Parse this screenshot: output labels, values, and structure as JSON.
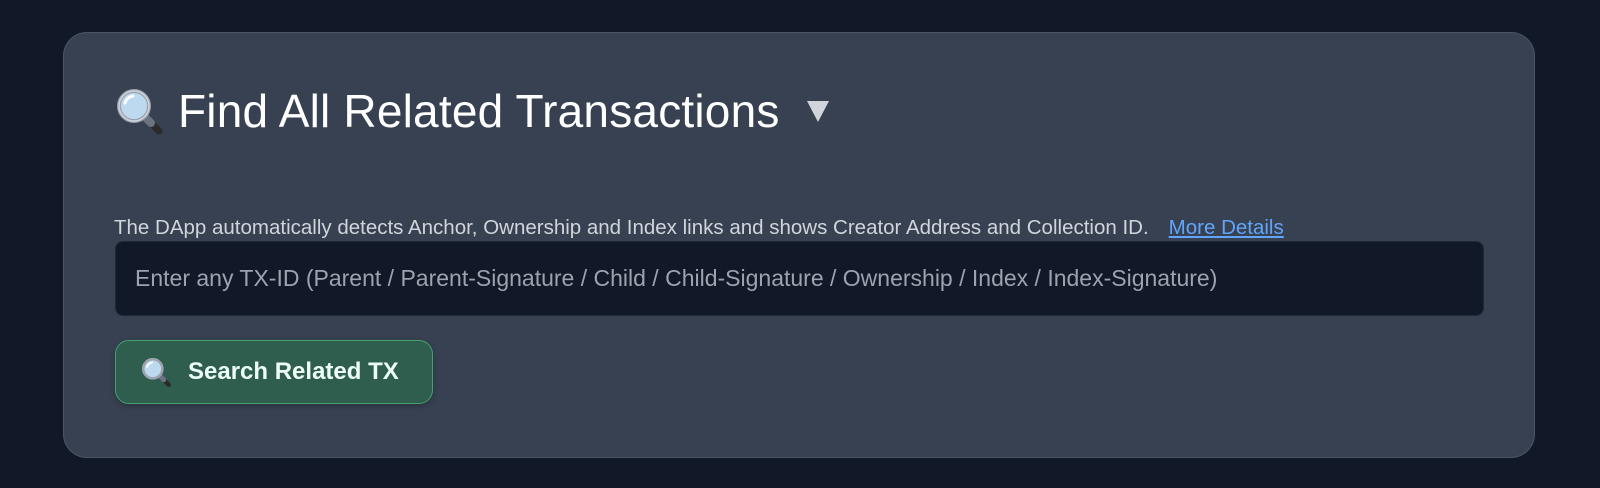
{
  "card": {
    "title": "Find All Related Transactions",
    "title_icon": "magnifying-glass-icon",
    "toggle_icon": "triangle-down-icon",
    "description": "The DApp automatically detects Anchor, Ownership and Index links and shows Creator Address and Collection ID.",
    "more_details_label": "More Details"
  },
  "search": {
    "placeholder": "Enter any TX-ID (Parent / Parent-Signature / Child / Child-Signature / Ownership / Index / Index-Signature)",
    "value": "",
    "button_label": "Search Related TX",
    "button_icon": "magnifying-glass-icon"
  },
  "colors": {
    "background": "#111827",
    "card": "#374151",
    "input_bg": "#111827",
    "link": "#60a5fa",
    "button_bg": "#2f5d4e",
    "button_border": "#46a06f"
  }
}
